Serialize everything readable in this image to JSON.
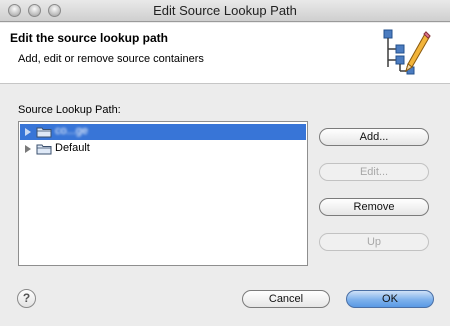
{
  "window": {
    "title": "Edit Source Lookup Path"
  },
  "header": {
    "title": "Edit the source lookup path",
    "subtitle": "Add, edit or remove source containers",
    "icon": "source-path-edit-icon"
  },
  "list": {
    "label": "Source Lookup Path:",
    "items": [
      {
        "label": "co...ge",
        "icon": "folder-icon",
        "selected": true,
        "expanded": false
      },
      {
        "label": "Default",
        "icon": "folder-icon",
        "selected": false,
        "expanded": false
      }
    ]
  },
  "buttons": {
    "add": "Add...",
    "edit": "Edit...",
    "remove": "Remove",
    "up": "Up",
    "cancel": "Cancel",
    "ok": "OK",
    "help": "?"
  },
  "colors": {
    "selection": "#3875d7",
    "ok_button": "#6aa4e8"
  }
}
